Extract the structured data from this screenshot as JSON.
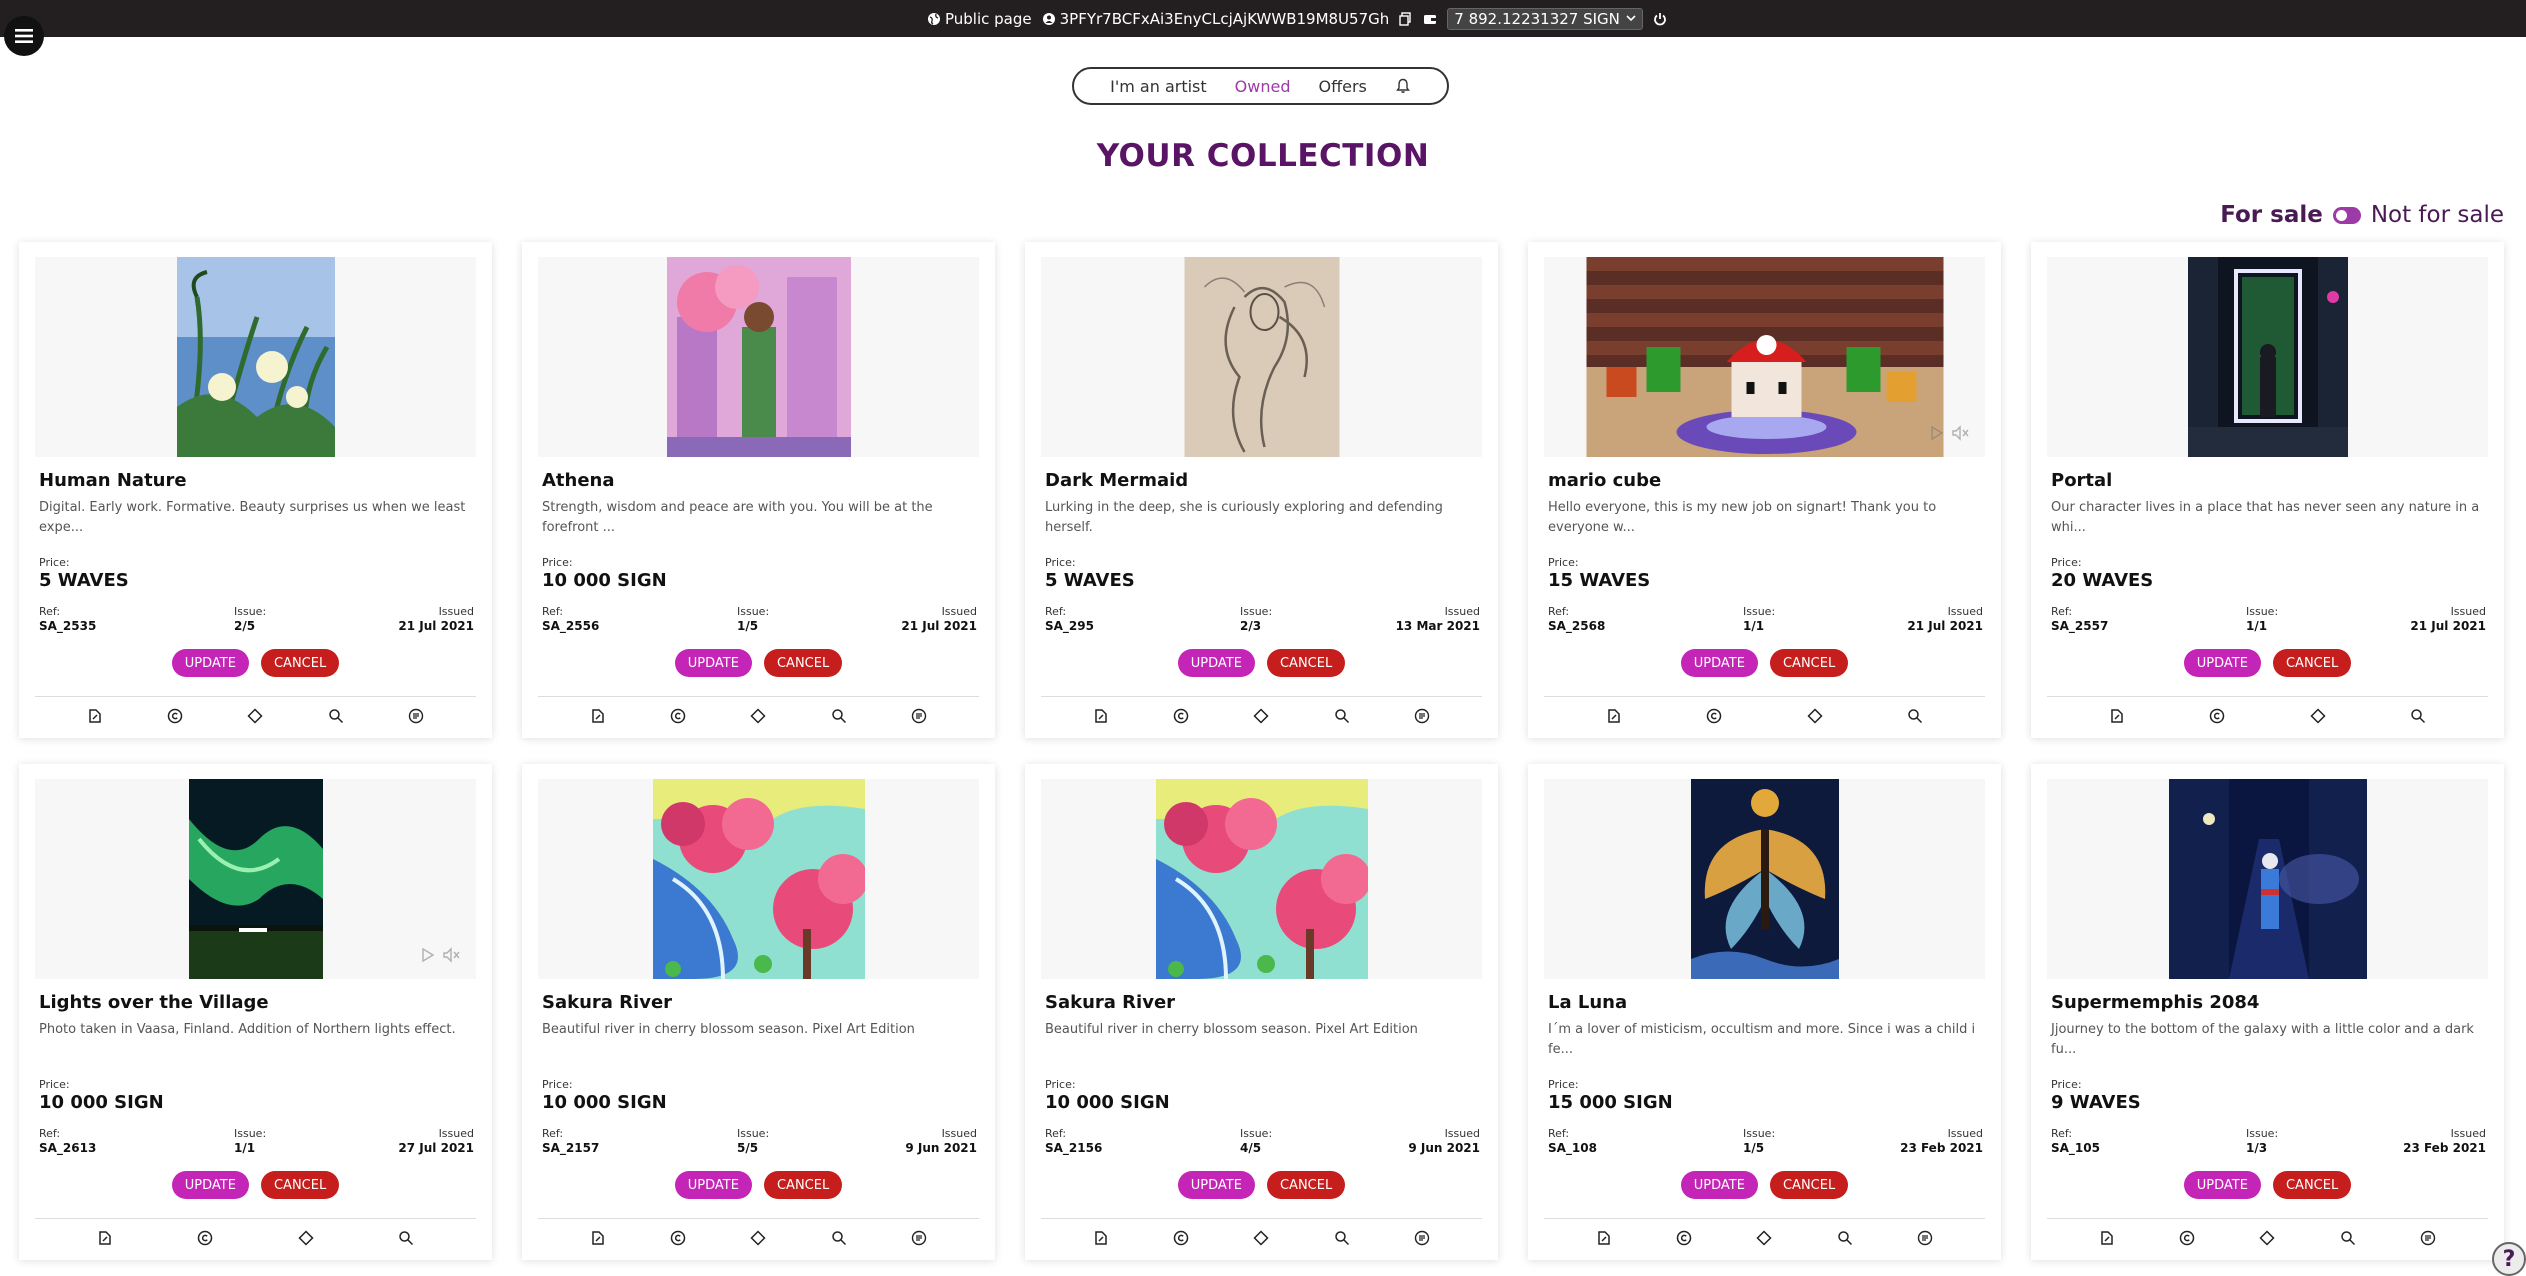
{
  "topbar": {
    "public_page": "Public page",
    "address": "3PFYr7BCFxAi3EnyCLcjAjKWWB19M8U57Gh",
    "balance": "7 892.12231327 SIGN"
  },
  "tabs": [
    "I'm an artist",
    "Owned",
    "Offers"
  ],
  "active_tab": "Owned",
  "page_title": "YOUR COLLECTION",
  "toggle": {
    "on_label": "For sale",
    "off_label": "Not for sale",
    "state": "for-sale"
  },
  "labels": {
    "price": "Price:",
    "ref": "Ref:",
    "issue": "Issue:",
    "issued": "Issued",
    "update": "UPDATE",
    "cancel": "CANCEL"
  },
  "cards": [
    {
      "title": "Human Nature",
      "desc": "Digital. Early work. Formative. Beauty surprises us when we least expe...",
      "price": "5 WAVES",
      "ref": "SA_2535",
      "issue": "2/5",
      "issued": "21 Jul 2021",
      "art": "dandelions",
      "has_offer_icon": true,
      "has_media": false
    },
    {
      "title": "Athena",
      "desc": "Strength, wisdom and peace are with you. You will be at the forefront ...",
      "price": "10 000 SIGN",
      "ref": "SA_2556",
      "issue": "1/5",
      "issued": "21 Jul 2021",
      "art": "anime-city",
      "has_offer_icon": true,
      "has_media": false
    },
    {
      "title": "Dark Mermaid",
      "desc": "Lurking in the deep, she is curiously exploring and defending herself.",
      "price": "5 WAVES",
      "ref": "SA_295",
      "issue": "2/3",
      "issued": "13 Mar 2021",
      "art": "pencil-sketch",
      "has_offer_icon": true,
      "has_media": false
    },
    {
      "title": "mario cube",
      "desc": "Hello everyone, this is my new job on signart! Thank you to everyone w...",
      "price": "15 WAVES",
      "ref": "SA_2568",
      "issue": "1/1",
      "issued": "21 Jul 2021",
      "art": "mario-3d",
      "has_offer_icon": false,
      "has_media": true
    },
    {
      "title": "Portal",
      "desc": "Our character lives in a place that has never seen any nature in a whi...",
      "price": "20 WAVES",
      "ref": "SA_2557",
      "issue": "1/1",
      "issued": "21 Jul 2021",
      "art": "neon-portal",
      "has_offer_icon": false,
      "has_media": false
    },
    {
      "title": "Lights over the Village",
      "desc": "Photo taken in Vaasa, Finland. Addition of Northern lights effect.",
      "price": "10 000 SIGN",
      "ref": "SA_2613",
      "issue": "1/1",
      "issued": "27 Jul 2021",
      "art": "aurora",
      "has_offer_icon": false,
      "has_media": true
    },
    {
      "title": "Sakura River",
      "desc": "Beautiful river in cherry blossom season. Pixel Art Edition",
      "price": "10 000 SIGN",
      "ref": "SA_2157",
      "issue": "5/5",
      "issued": "9 Jun 2021",
      "art": "sakura",
      "has_offer_icon": true,
      "has_media": false
    },
    {
      "title": "Sakura River",
      "desc": "Beautiful river in cherry blossom season. Pixel Art Edition",
      "price": "10 000 SIGN",
      "ref": "SA_2156",
      "issue": "4/5",
      "issued": "9 Jun 2021",
      "art": "sakura",
      "has_offer_icon": true,
      "has_media": false
    },
    {
      "title": "La Luna",
      "desc": "I´m a lover of misticism, occultism and more. Since i was a child i fe...",
      "price": "15 000 SIGN",
      "ref": "SA_108",
      "issue": "1/5",
      "issued": "23 Feb 2021",
      "art": "moth",
      "has_offer_icon": true,
      "has_media": false
    },
    {
      "title": "Supermemphis 2084",
      "desc": "Jjourney to the bottom of the galaxy with a little color and a dark fu...",
      "price": "9 WAVES",
      "ref": "SA_105",
      "issue": "1/3",
      "issued": "23 Feb 2021",
      "art": "night-alley",
      "has_offer_icon": true,
      "has_media": false
    }
  ],
  "help": "?"
}
